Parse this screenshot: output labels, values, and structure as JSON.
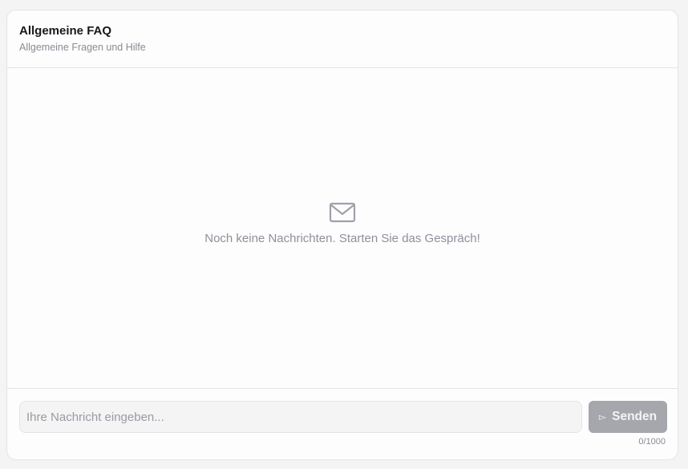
{
  "header": {
    "title": "Allgemeine FAQ",
    "subtitle": "Allgemeine Fragen und Hilfe"
  },
  "messages": {
    "empty_icon": "mail-icon",
    "empty_text": "Noch keine Nachrichten. Starten Sie das Gespräch!"
  },
  "composer": {
    "placeholder": "Ihre Nachricht eingeben...",
    "value": "",
    "send_icon": "send-icon",
    "send_label": "Senden",
    "counter": "0/1000"
  },
  "colors": {
    "button_disabled": "#a6a6ad",
    "muted_text": "#8f8f9b"
  }
}
